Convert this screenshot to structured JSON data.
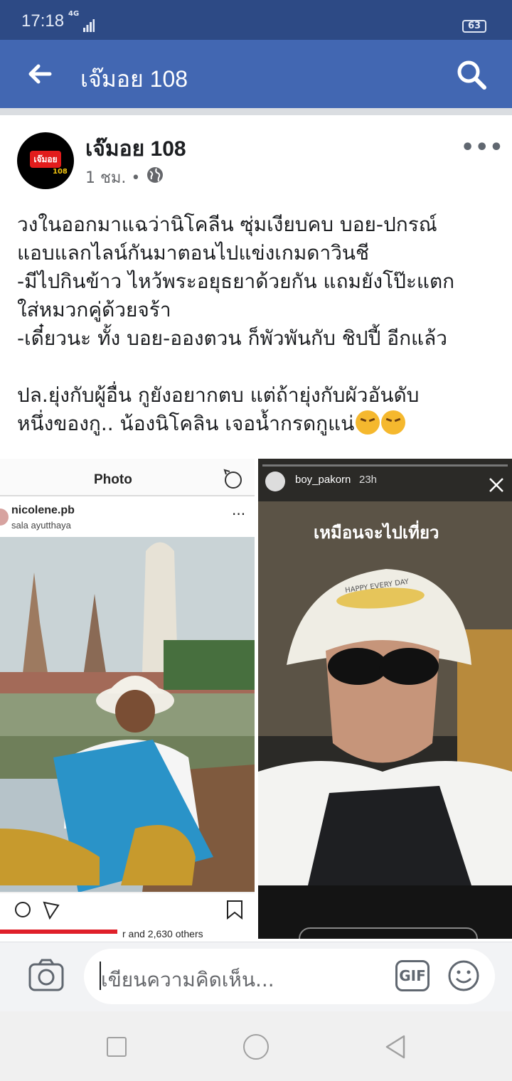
{
  "status_bar": {
    "time": "17:18",
    "network": "4G",
    "battery": "63"
  },
  "app_bar": {
    "title": "เจ๊มอย 108"
  },
  "post": {
    "author": "เจ๊มอย 108",
    "avatar_text": "เจ๊มอย",
    "avatar_number": "108",
    "time": "1 ชม. •",
    "lines": [
      "วงในออกมาแฉว่านิโคลีน ซุ่มเงียบคบ บอย-ปกรณ์",
      "แอบแลกไลน์กันมาตอนไปแข่งเกมดาวินชี",
      "-มีไปกินข้าว ไหว้พระอยุธยาด้วยกัน แถมยังโป๊ะแตก",
      "ใส่หมวกคู่ด้วยจร้า",
      "-เดี๋ยวนะ ทั้ง บอย-อองตวน ก็พัวพันกับ ชิปปี้ อีกแล้ว",
      "",
      "ปล.ยุ่งกับผู้อื่น กูยังอยากตบ แต่ถ้ายุ่งกับผัวอันดับ",
      "หนึ่งของกู.. น้องนิโคลิน เจอน้ำกรดกูแน่"
    ]
  },
  "left_photo": {
    "header": "Photo",
    "username": "nicolene.pb",
    "location": "sala ayutthaya",
    "likes_text": "r and 2,630 others"
  },
  "right_photo": {
    "username": "boy_pakorn",
    "time": "23h",
    "caption": "เหมือนจะไปเที่ยว",
    "hat_text": "HAPPY EVERY DAY"
  },
  "composer": {
    "placeholder": "เขียนความคิดเห็น...",
    "gif_label": "GIF"
  }
}
